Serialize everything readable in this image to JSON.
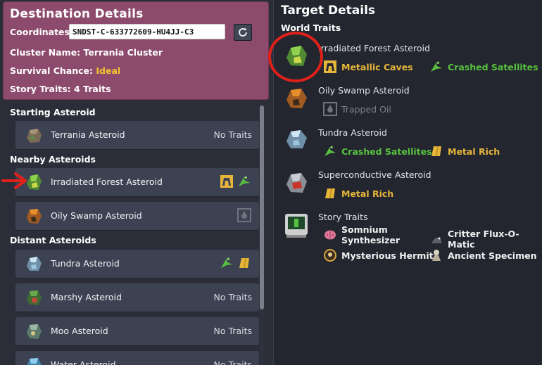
{
  "destination": {
    "title": "Destination Details",
    "coordinates_label": "Coordinates:",
    "coordinates_value": "SNDST-C-633772609-HU4JJ-C3",
    "cluster_label": "Cluster Name:",
    "cluster_value": "Terrania Cluster",
    "survival_label": "Survival Chance:",
    "survival_value": "Ideal",
    "story_label": "Story Traits:",
    "story_value": "4 Traits",
    "reroll_icon": "reroll-icon"
  },
  "list": {
    "starting_header": "Starting Asteroid",
    "nearby_header": "Nearby Asteroids",
    "distant_header": "Distant Asteroids",
    "starting": [
      {
        "name": "Terrania Asteroid",
        "traits": "No Traits"
      }
    ],
    "nearby": [
      {
        "name": "Irradiated Forest Asteroid",
        "traits": ""
      },
      {
        "name": "Oily Swamp Asteroid",
        "traits": ""
      }
    ],
    "distant": [
      {
        "name": "Tundra Asteroid",
        "traits": ""
      },
      {
        "name": "Marshy Asteroid",
        "traits": "No Traits"
      },
      {
        "name": "Moo Asteroid",
        "traits": "No Traits"
      },
      {
        "name": "Water Asteroid",
        "traits": "No Traits"
      }
    ]
  },
  "target": {
    "title": "Target Details",
    "world_traits_header": "World Traits",
    "asteroids": [
      {
        "name": "Irradiated Forest Asteroid",
        "traits": [
          {
            "label": "Metallic Caves",
            "color": "gold"
          },
          {
            "label": "Crashed Satellites",
            "color": "green"
          }
        ]
      },
      {
        "name": "Oily Swamp Asteroid",
        "traits": [
          {
            "label": "Trapped Oil",
            "color": "gray"
          }
        ]
      },
      {
        "name": "Tundra Asteroid",
        "traits": [
          {
            "label": "Crashed Satellites",
            "color": "green"
          },
          {
            "label": "Metal Rich",
            "color": "gold"
          }
        ]
      },
      {
        "name": "Superconductive Asteroid",
        "traits": [
          {
            "label": "Metal Rich",
            "color": "gold"
          }
        ]
      }
    ],
    "story_traits_header": "Story Traits",
    "story_traits": [
      {
        "label": "Somnium Synthesizer",
        "icon": "brain-icon"
      },
      {
        "label": "Critter Flux-O-Matic",
        "icon": "critter-icon"
      },
      {
        "label": "Mysterious Hermit",
        "icon": "hermit-icon"
      },
      {
        "label": "Ancient Specimen",
        "icon": "specimen-icon"
      }
    ]
  },
  "colors": {
    "accent_panel": "#8c4a6c",
    "ideal": "#f2c62b",
    "gold_trait": "#e6b63a",
    "green_trait": "#57c13f",
    "highlight_red": "#e0201a"
  }
}
